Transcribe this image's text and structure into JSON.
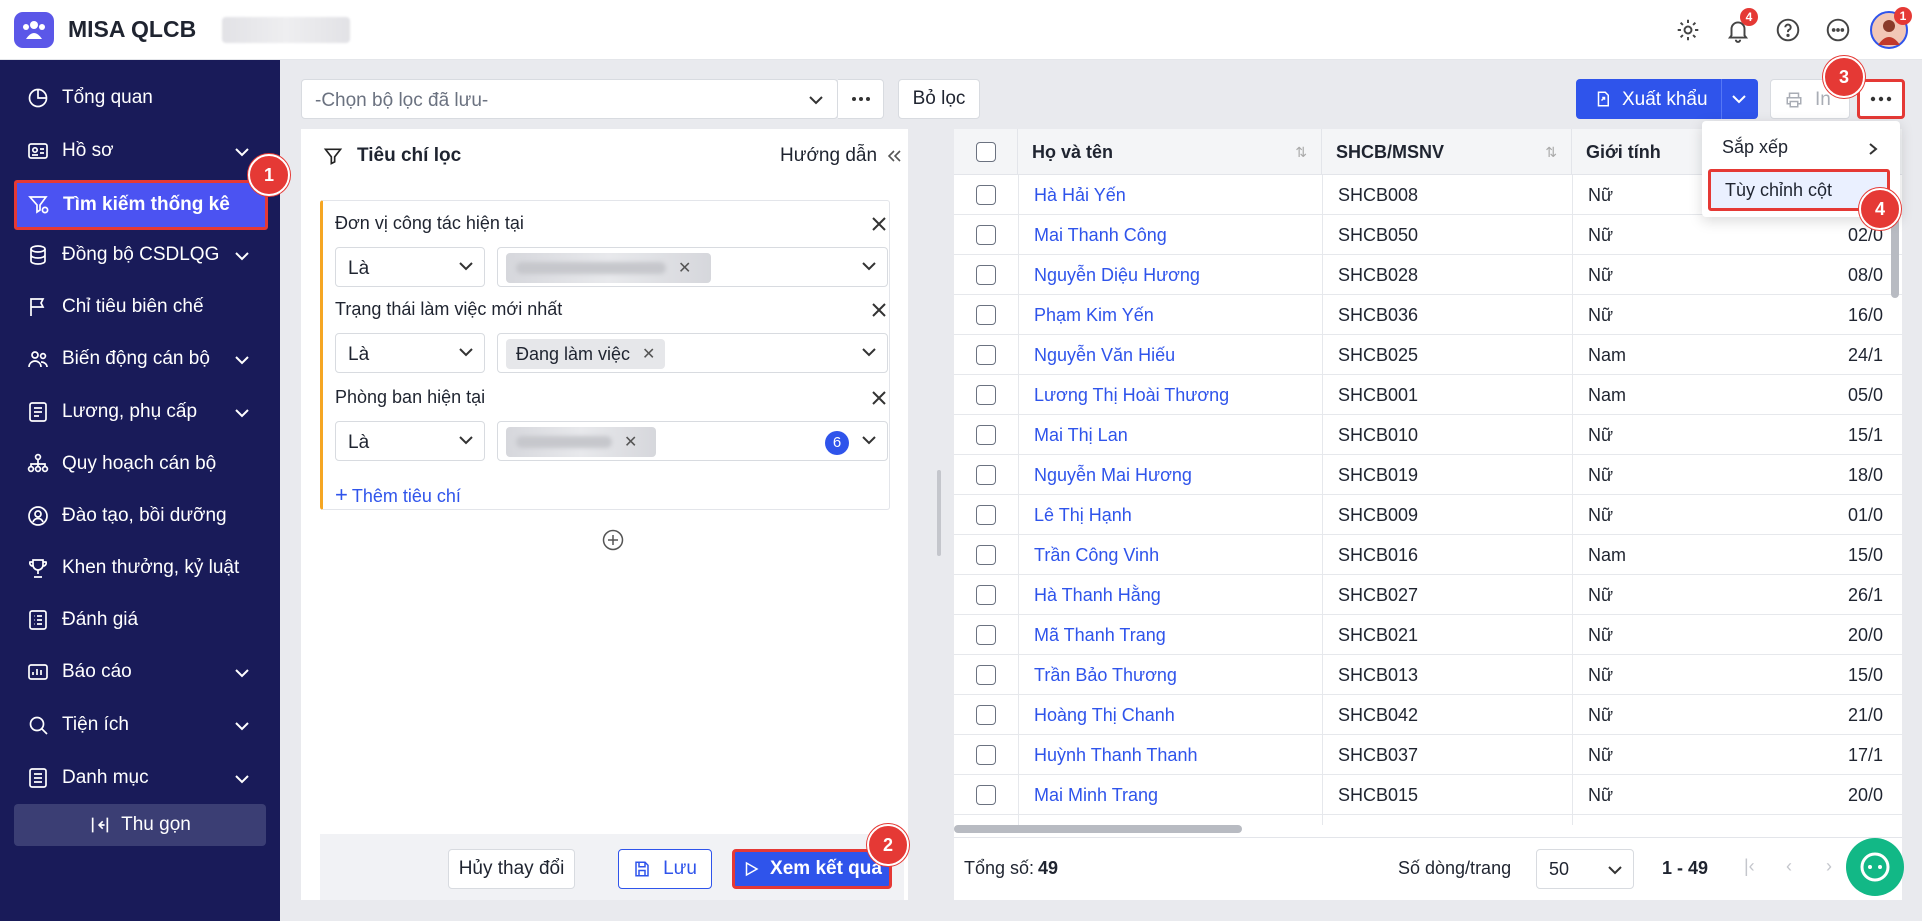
{
  "app": {
    "title": "MISA QLCB"
  },
  "topbar": {
    "notif_count": "4",
    "avatar_badge": "1"
  },
  "sidebar": {
    "items": [
      {
        "label": "Tổng quan",
        "icon": "pie-chart-icon",
        "has_children": false
      },
      {
        "label": "Hồ sơ",
        "icon": "id-card-icon",
        "has_children": true
      },
      {
        "label": "Tìm kiếm thống kê",
        "icon": "filter-search-icon",
        "has_children": false,
        "active": true
      },
      {
        "label": "Đồng bộ CSDLQG",
        "icon": "database-sync-icon",
        "has_children": true
      },
      {
        "label": "Chỉ tiêu biên chế",
        "icon": "flag-icon",
        "has_children": false
      },
      {
        "label": "Biến động cán bộ",
        "icon": "people-icon",
        "has_children": true
      },
      {
        "label": "Lương, phụ cấp",
        "icon": "salary-icon",
        "has_children": true
      },
      {
        "label": "Quy hoạch cán bộ",
        "icon": "org-chart-icon",
        "has_children": false
      },
      {
        "label": "Đào tạo, bồi dưỡng",
        "icon": "person-badge-icon",
        "has_children": false
      },
      {
        "label": "Khen thưởng, kỷ luật",
        "icon": "trophy-icon",
        "has_children": false
      },
      {
        "label": "Đánh giá",
        "icon": "checklist-icon",
        "has_children": false
      },
      {
        "label": "Báo cáo",
        "icon": "report-icon",
        "has_children": true
      },
      {
        "label": "Tiện ích",
        "icon": "search-icon",
        "has_children": true
      },
      {
        "label": "Danh mục",
        "icon": "list-icon",
        "has_children": true
      }
    ],
    "collapse_label": "Thu gọn"
  },
  "filterbar": {
    "saved_filter_placeholder": "-Chọn bộ lọc đã lưu-",
    "clear_label": "Bỏ lọc"
  },
  "criteria": {
    "title": "Tiêu chí lọc",
    "guide": "Hướng dẫn",
    "rows": [
      {
        "label": "Đơn vị công tác hiện tại",
        "op": "Là",
        "chip": ""
      },
      {
        "label": "Trạng thái làm việc mới nhất",
        "op": "Là",
        "chip": "Đang làm việc"
      },
      {
        "label": "Phòng ban hiện tại",
        "op": "Là",
        "chip": "",
        "count": "6"
      }
    ],
    "add_label": "Thêm tiêu chí",
    "cancel_label": "Hủy thay đổi",
    "save_label": "Lưu",
    "run_label": "Xem kết quả"
  },
  "toolbar": {
    "export_label": "Xuất khẩu",
    "print_label": "In"
  },
  "menu": {
    "sort_label": "Sắp xếp",
    "custom_columns_label": "Tùy chỉnh cột"
  },
  "table": {
    "columns": [
      "Họ và tên",
      "SHCB/MSNV",
      "Giới tính"
    ],
    "rows": [
      {
        "name": "Hà Hải Yến",
        "code": "SHCB008",
        "gender": "Nữ",
        "date": ""
      },
      {
        "name": "Mai Thanh Công",
        "code": "SHCB050",
        "gender": "Nữ",
        "date": "02/0"
      },
      {
        "name": "Nguyễn Diệu Hương",
        "code": "SHCB028",
        "gender": "Nữ",
        "date": "08/0"
      },
      {
        "name": "Phạm Kim Yến",
        "code": "SHCB036",
        "gender": "Nữ",
        "date": "16/0"
      },
      {
        "name": "Nguyễn Văn Hiếu",
        "code": "SHCB025",
        "gender": "Nam",
        "date": "24/1"
      },
      {
        "name": "Lương Thị Hoài Thương",
        "code": "SHCB001",
        "gender": "Nam",
        "date": "05/0"
      },
      {
        "name": "Mai Thị Lan",
        "code": "SHCB010",
        "gender": "Nữ",
        "date": "15/1"
      },
      {
        "name": "Nguyễn Mai Hương",
        "code": "SHCB019",
        "gender": "Nữ",
        "date": "18/0"
      },
      {
        "name": "Lê Thị Hạnh",
        "code": "SHCB009",
        "gender": "Nữ",
        "date": "01/0"
      },
      {
        "name": "Trần Công Vinh",
        "code": "SHCB016",
        "gender": "Nam",
        "date": "15/0"
      },
      {
        "name": "Hà Thanh Hằng",
        "code": "SHCB027",
        "gender": "Nữ",
        "date": "26/1"
      },
      {
        "name": "Mã Thanh Trang",
        "code": "SHCB021",
        "gender": "Nữ",
        "date": "20/0"
      },
      {
        "name": "Trần Bảo Thương",
        "code": "SHCB013",
        "gender": "Nữ",
        "date": "15/0"
      },
      {
        "name": "Hoàng Thị Chanh",
        "code": "SHCB042",
        "gender": "Nữ",
        "date": "21/0"
      },
      {
        "name": "Huỳnh Thanh Thanh",
        "code": "SHCB037",
        "gender": "Nữ",
        "date": "17/1"
      },
      {
        "name": "Mai Minh Trang",
        "code": "SHCB015",
        "gender": "Nữ",
        "date": "20/0"
      }
    ],
    "total_label": "Tổng số:",
    "total_value": "49",
    "page_size_label": "Số dòng/trang",
    "page_size": "50",
    "range": "1 - 49"
  },
  "steps": [
    "1",
    "2",
    "3",
    "4"
  ],
  "colors": {
    "sidebar_bg": "#191b59",
    "accent": "#2f54eb",
    "highlight": "#e53935"
  }
}
